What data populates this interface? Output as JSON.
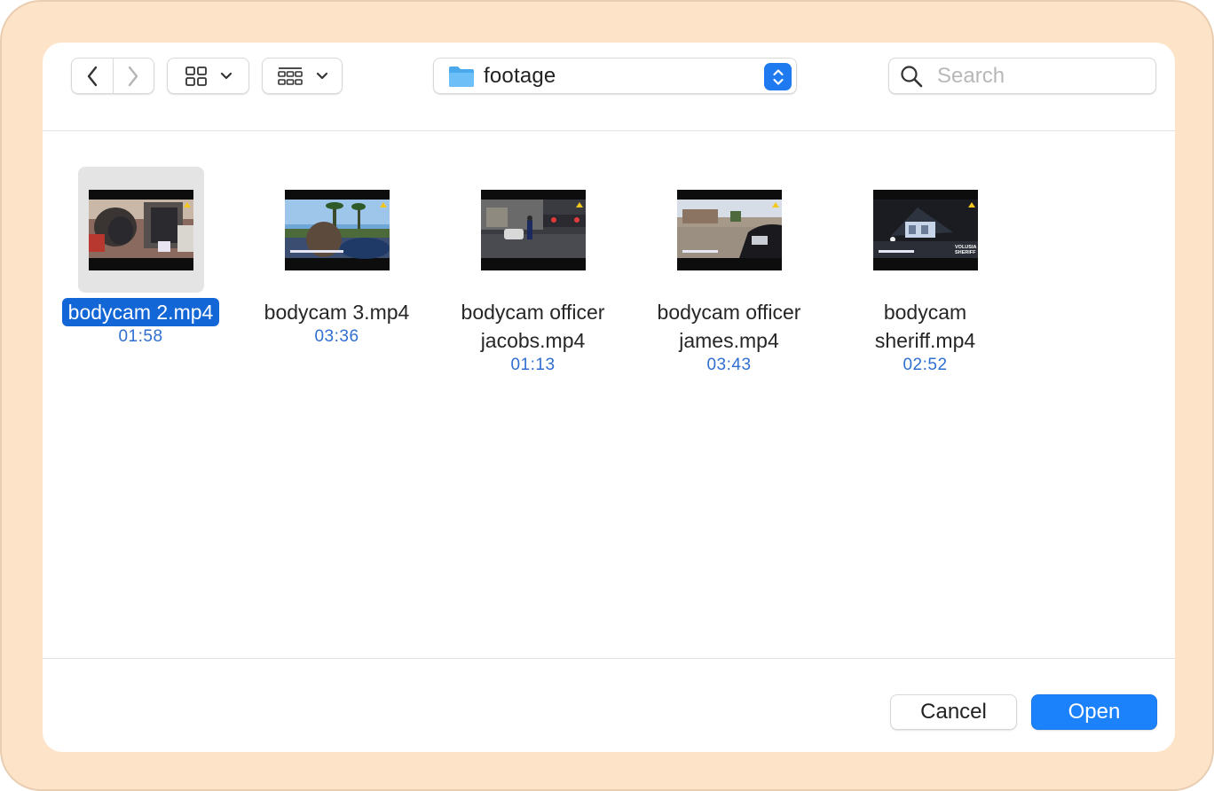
{
  "window": {
    "current_folder": "footage",
    "search_placeholder": "Search"
  },
  "toolbar": {
    "icons": {
      "back": "chevron-left-icon",
      "forward": "chevron-right-icon",
      "view": "grid-view-icon",
      "group": "group-view-icon",
      "folder": "folder-icon",
      "search": "magnifier-icon"
    }
  },
  "files": [
    {
      "name": "bodycam 2.mp4",
      "duration": "01:58",
      "selected": true
    },
    {
      "name": "bodycam 3.mp4",
      "duration": "03:36",
      "selected": false
    },
    {
      "name": "bodycam officer jacobs.mp4",
      "duration": "01:13",
      "selected": false
    },
    {
      "name": "bodycam officer james.mp4",
      "duration": "03:43",
      "selected": false
    },
    {
      "name": "bodycam sheriff.mp4",
      "duration": "02:52",
      "selected": false
    }
  ],
  "thumbnail_overlays": {
    "sheriff_logo": "VOLUSIA SHERIFF"
  },
  "footer": {
    "cancel_label": "Cancel",
    "open_label": "Open"
  },
  "colors": {
    "accent": "#1c82fb",
    "selection": "#1366d6",
    "duration_text": "#2f6fd1",
    "frame": "#fde3c8"
  }
}
